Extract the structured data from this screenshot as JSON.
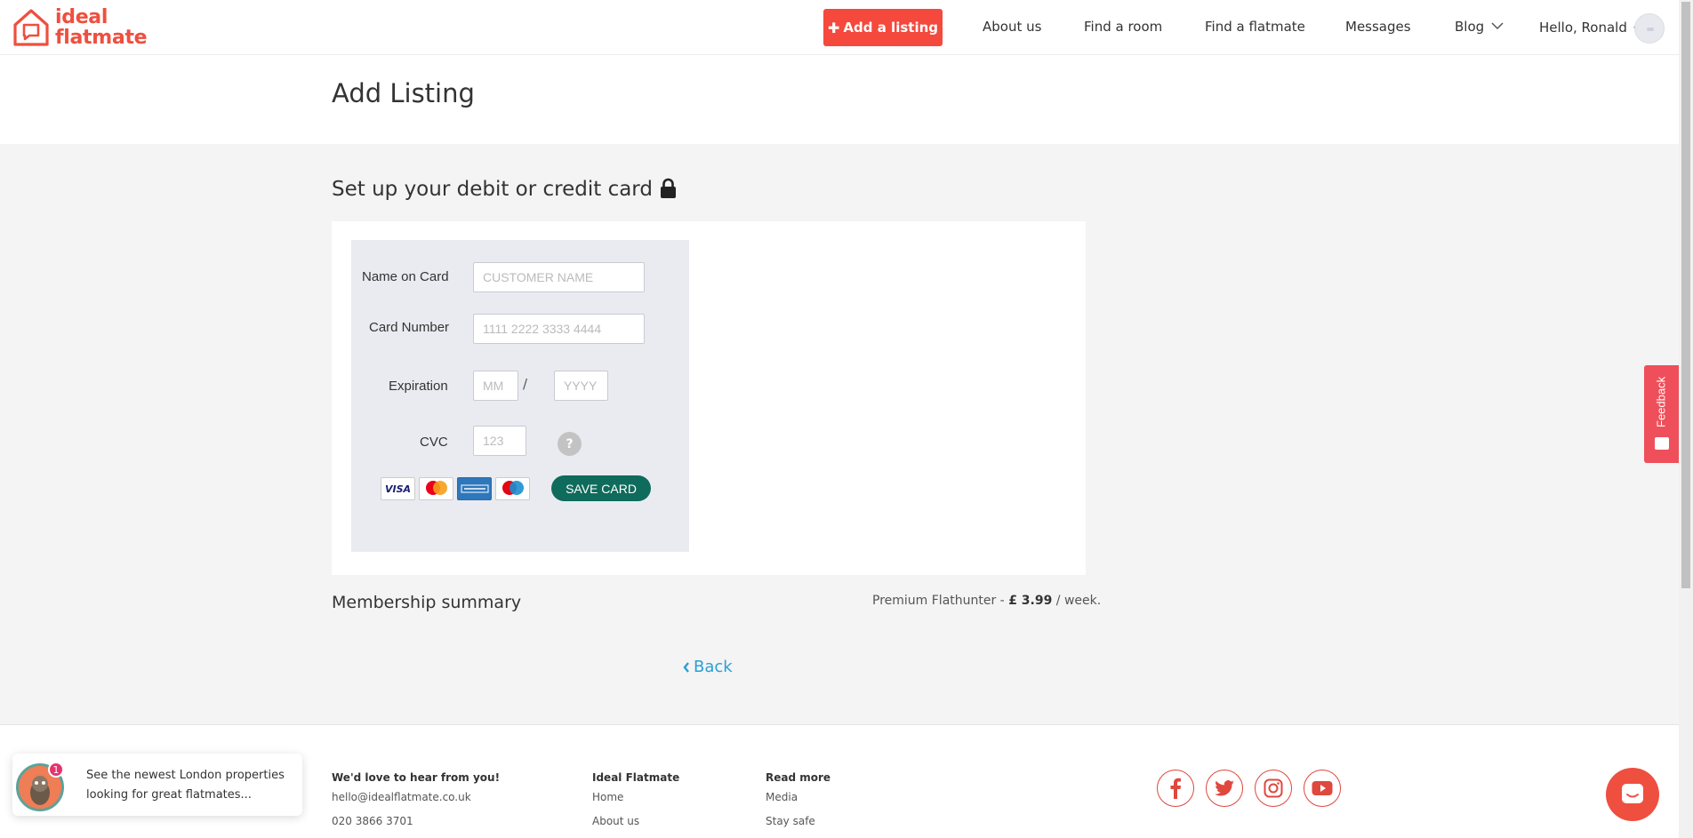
{
  "header": {
    "logo_line1": "ideal",
    "logo_line2": "flatmate",
    "add_listing_label": "Add a listing",
    "nav": [
      "About us",
      "Find a room",
      "Find a flatmate",
      "Messages",
      "Blog"
    ],
    "greeting": "Hello, Ronald"
  },
  "page": {
    "title": "Add Listing",
    "section_title": "Set up your debit or credit card"
  },
  "card_form": {
    "name_label": "Name on Card",
    "name_placeholder": "CUSTOMER NAME",
    "number_label": "Card Number",
    "number_placeholder": "1111 2222 3333 4444",
    "expiration_label": "Expiration",
    "month_placeholder": "MM",
    "separator": "/",
    "year_placeholder": "YYYY",
    "cvc_label": "CVC",
    "cvc_placeholder": "123",
    "help_glyph": "?",
    "save_label": "SAVE CARD",
    "card_brands": [
      "visa",
      "mastercard",
      "american-express",
      "maestro"
    ]
  },
  "summary": {
    "label": "Membership summary",
    "plan": "Premium Flathunter - ",
    "price": "£ 3.99",
    "period": " / week."
  },
  "back_label": "Back",
  "footer": {
    "contact_heading": "We'd love to hear from you!",
    "email": "hello@idealflatmate.co.uk",
    "phone": "020 3866 3701",
    "col1_heading": "Ideal Flatmate",
    "col1_links": [
      "Home",
      "About us"
    ],
    "col2_heading": "Read more",
    "col2_links": [
      "Media",
      "Stay safe"
    ],
    "social": [
      "facebook-icon",
      "twitter-icon",
      "instagram-icon",
      "youtube-icon"
    ]
  },
  "feedback_label": "Feedback",
  "toast": {
    "badge": "1",
    "text": "See the newest London properties looking for great flatmates..."
  },
  "colors": {
    "brand": "#ef4f3f",
    "save_button": "#0f6b5c",
    "link": "#2a9fd6",
    "form_bg": "#eaebf0",
    "page_bg": "#f4f4f4"
  }
}
